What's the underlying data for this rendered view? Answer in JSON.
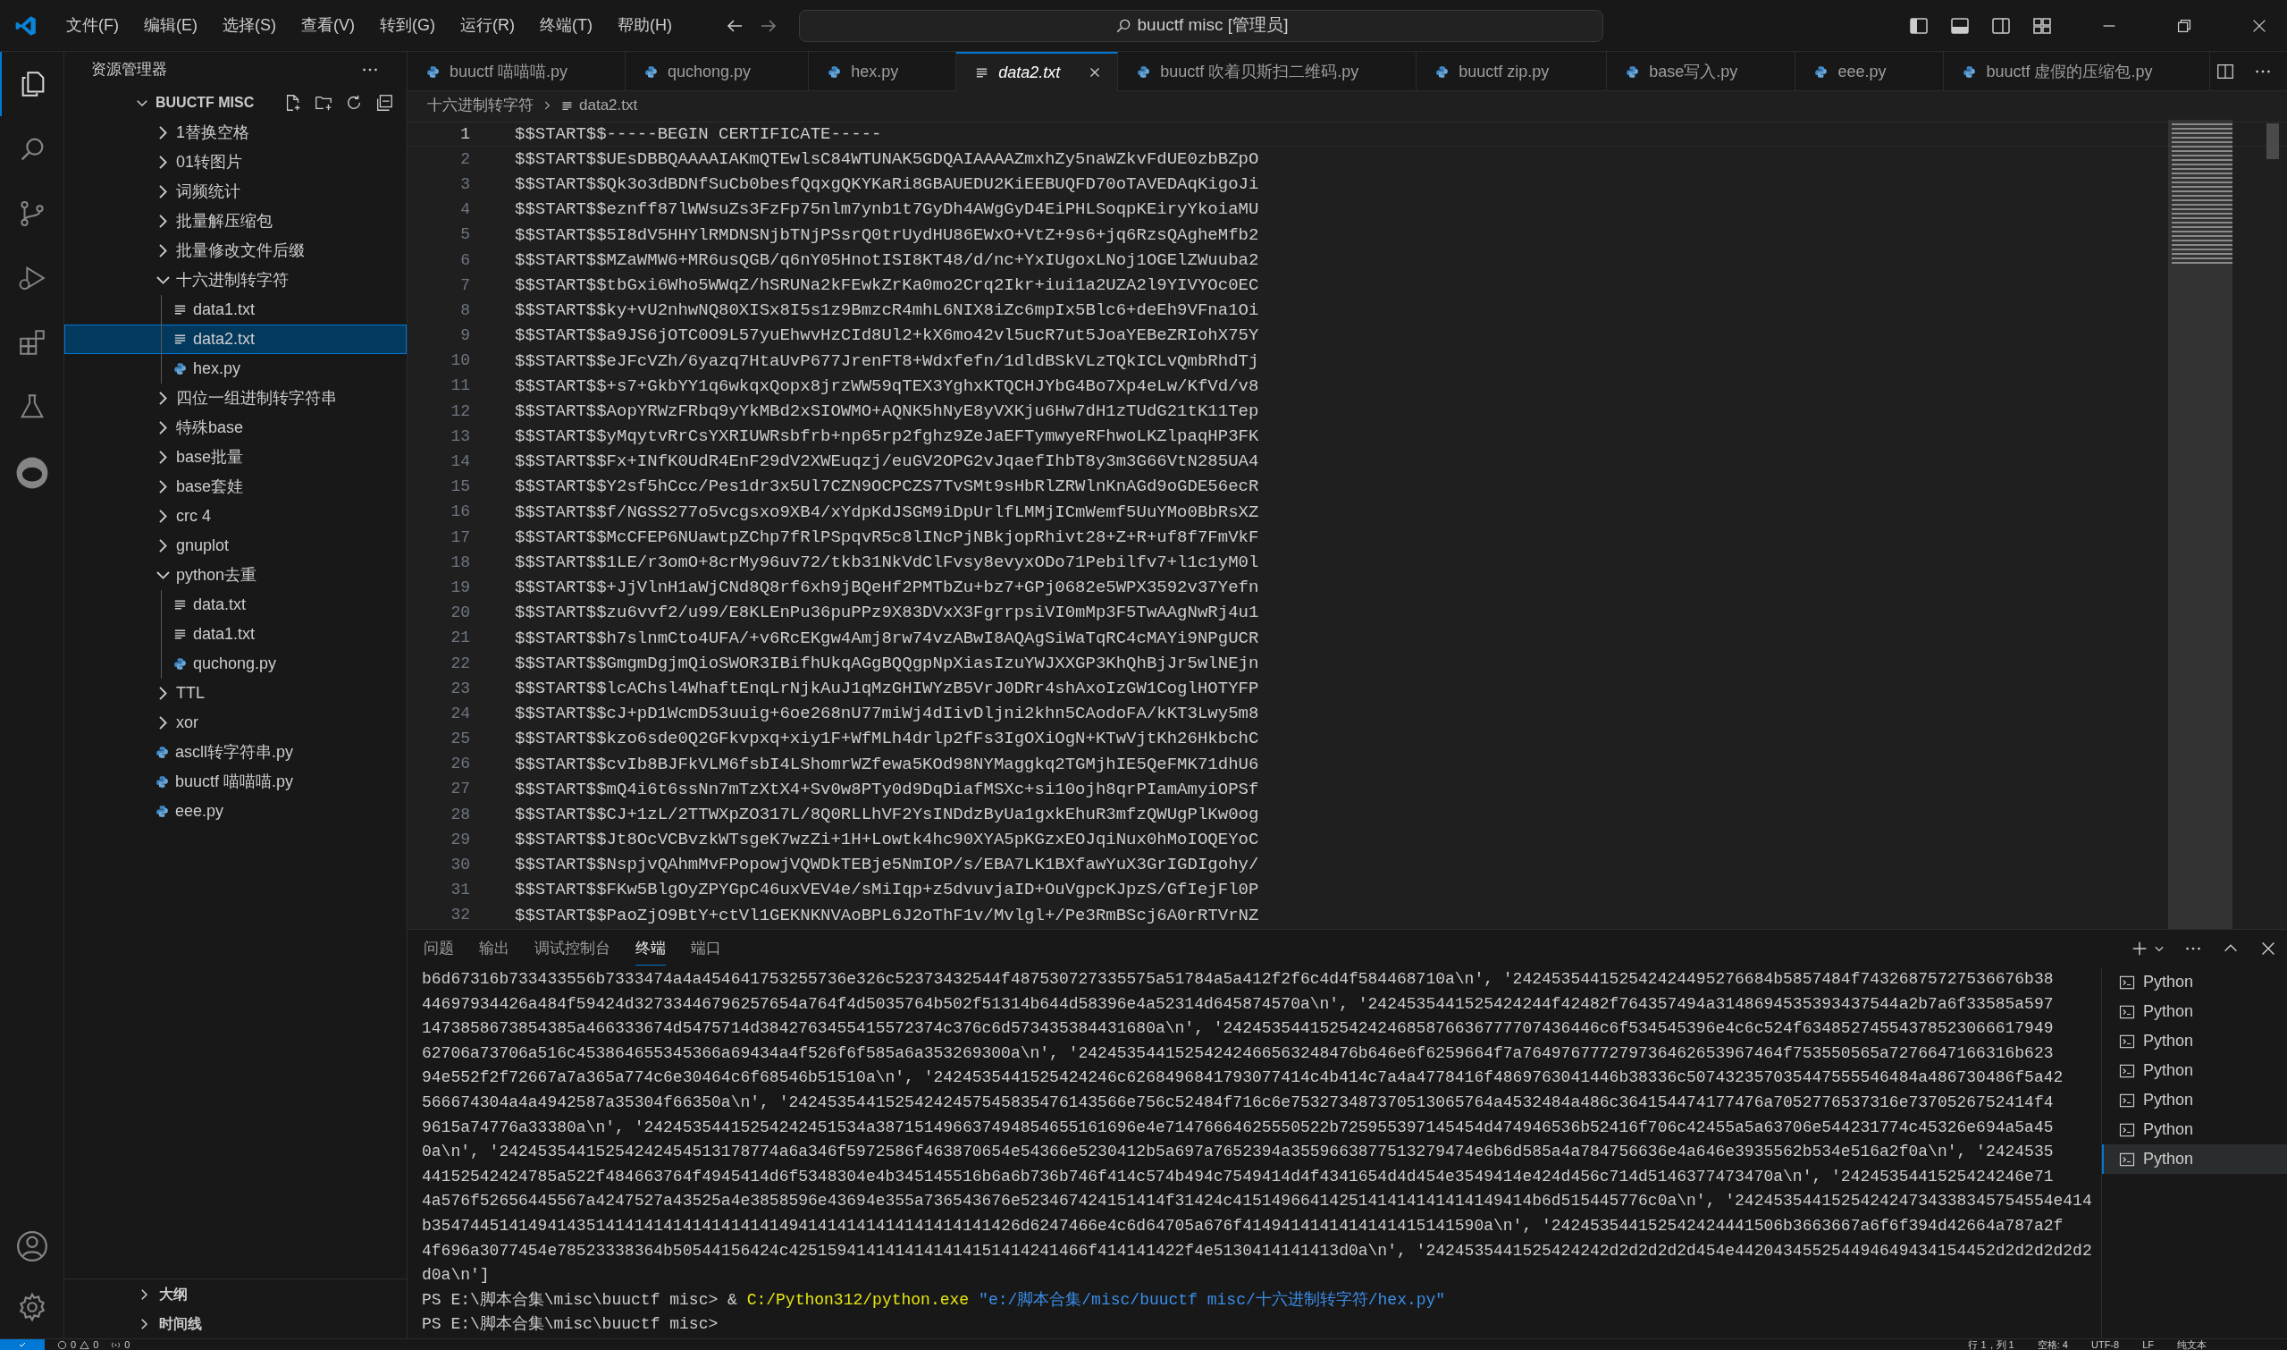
{
  "menu": [
    "文件(F)",
    "编辑(E)",
    "选择(S)",
    "查看(V)",
    "转到(G)",
    "运行(R)",
    "终端(T)",
    "帮助(H)"
  ],
  "command_center": {
    "text": "buuctf misc [管理员]"
  },
  "sidebar": {
    "title": "资源管理器",
    "root": "BUUCTF MISC",
    "items": [
      {
        "kind": "folder",
        "label": "1替换空格",
        "expanded": false,
        "selected": false
      },
      {
        "kind": "folder",
        "label": "01转图片",
        "expanded": false,
        "selected": false
      },
      {
        "kind": "folder",
        "label": "词频统计",
        "expanded": false,
        "selected": false
      },
      {
        "kind": "folder",
        "label": "批量解压缩包",
        "expanded": false,
        "selected": false
      },
      {
        "kind": "folder",
        "label": "批量修改文件后缀",
        "expanded": false,
        "selected": false
      },
      {
        "kind": "folder",
        "label": "十六进制转字符",
        "expanded": true,
        "selected": false,
        "children": [
          {
            "kind": "txt",
            "label": "data1.txt",
            "selected": false
          },
          {
            "kind": "txt",
            "label": "data2.txt",
            "selected": true
          },
          {
            "kind": "py",
            "label": "hex.py",
            "selected": false
          }
        ]
      },
      {
        "kind": "folder",
        "label": "四位一组进制转字符串",
        "expanded": false,
        "selected": false
      },
      {
        "kind": "folder",
        "label": "特殊base",
        "expanded": false,
        "selected": false
      },
      {
        "kind": "folder",
        "label": "base批量",
        "expanded": false,
        "selected": false
      },
      {
        "kind": "folder",
        "label": "base套娃",
        "expanded": false,
        "selected": false
      },
      {
        "kind": "folder",
        "label": "crc 4",
        "expanded": false,
        "selected": false
      },
      {
        "kind": "folder",
        "label": "gnuplot",
        "expanded": false,
        "selected": false
      },
      {
        "kind": "folder",
        "label": "python去重",
        "expanded": true,
        "selected": false,
        "children": [
          {
            "kind": "txt",
            "label": "data.txt",
            "selected": false
          },
          {
            "kind": "txt",
            "label": "data1.txt",
            "selected": false
          },
          {
            "kind": "py",
            "label": "quchong.py",
            "selected": false
          }
        ]
      },
      {
        "kind": "folder",
        "label": "TTL",
        "expanded": false,
        "selected": false
      },
      {
        "kind": "folder",
        "label": "xor",
        "expanded": false,
        "selected": false
      },
      {
        "kind": "py",
        "label": "ascll转字符串.py",
        "selected": false
      },
      {
        "kind": "py",
        "label": "buuctf 喵喵喵.py",
        "selected": false
      },
      {
        "kind": "py",
        "label": "eee.py",
        "selected": false
      }
    ],
    "sections": [
      "大纲",
      "时间线"
    ]
  },
  "tabs": [
    {
      "kind": "py",
      "label": "buuctf 喵喵喵.py",
      "selected": false
    },
    {
      "kind": "py",
      "label": "quchong.py",
      "selected": false
    },
    {
      "kind": "py",
      "label": "hex.py",
      "selected": false
    },
    {
      "kind": "txt",
      "label": "data2.txt",
      "selected": true
    },
    {
      "kind": "py",
      "label": "buuctf 吹着贝斯扫二维码.py",
      "selected": false
    },
    {
      "kind": "py",
      "label": "buuctf zip.py",
      "selected": false
    },
    {
      "kind": "py",
      "label": "base写入.py",
      "selected": false
    },
    {
      "kind": "py",
      "label": "eee.py",
      "selected": false
    },
    {
      "kind": "py",
      "label": "buuctf 虚假的压缩包.py",
      "selected": false
    }
  ],
  "breadcrumb": [
    "十六进制转字符",
    "data2.txt"
  ],
  "editor": {
    "lines": [
      {
        "number": "1",
        "text": "$$START$$-----BEGIN CERTIFICATE-----",
        "selected": true
      },
      {
        "number": "2",
        "text": "$$START$$UEsDBBQAAAAIAKmQTEwlsC84WTUNAK5GDQAIAAAAZmxhZy5naWZkvFdUE0zbBZpO",
        "selected": false
      },
      {
        "number": "3",
        "text": "$$START$$Qk3o3dBDNfSuCb0besfQqxgQKYKaRi8GBAUEDU2KiEEBUQFD70oTAVEDAqKigoJi",
        "selected": false
      },
      {
        "number": "4",
        "text": "$$START$$eznff87lWWsuZs3FzFp75nlm7ynb1t7GyDh4AWgGyD4EiPHLSoqpKEiryYkoiaMU",
        "selected": false
      },
      {
        "number": "5",
        "text": "$$START$$5I8dV5HHYlRMDNSNjbTNjPSsrQ0trUydHU86EWxO+VtZ+9s6+jq6RzsQAgheMfb2",
        "selected": false
      },
      {
        "number": "6",
        "text": "$$START$$MZaWMW6+MR6usQGB/q6nY05HnotISI8KT48/d/nc+YxIUgoxLNoj1OGElZWuuba2",
        "selected": false
      },
      {
        "number": "7",
        "text": "$$START$$tbGxi6Who5WWqZ/hSRUNa2kFEwkZrKa0mo2Crq2Ikr+iui1a2UZA2l9YIVYOc0EC",
        "selected": false
      },
      {
        "number": "8",
        "text": "$$START$$ky+vU2nhwNQ80XISx8I5s1z9BmzcR4mhL6NIX8iZc6mpIx5Blc6+deEh9VFna1Oi",
        "selected": false
      },
      {
        "number": "9",
        "text": "$$START$$a9JS6jOTC0O9L57yuEhwvHzCId8Ul2+kX6mo42vl5ucR7ut5JoaYEBeZRIohX75Y",
        "selected": false
      },
      {
        "number": "10",
        "text": "$$START$$eJFcVZh/6yazq7HtaUvP677JrenFT8+Wdxfefn/1dldBSkVLzTQkICLvQmbRhdTj",
        "selected": false
      },
      {
        "number": "11",
        "text": "$$START$$+s7+GkbYY1q6wkqxQopx8jrzWW59qTEX3YghxKTQCHJYbG4Bo7Xp4eLw/KfVd/v8",
        "selected": false
      },
      {
        "number": "12",
        "text": "$$START$$AopYRWzFRbq9yYkMBd2xSIOWMO+AQNK5hNyE8yVXKju6Hw7dH1zTUdG21tK11Tep",
        "selected": false
      },
      {
        "number": "13",
        "text": "$$START$$yMqytvRrCsYXRIUWRsbfrb+np65rp2fghz9ZeJaEFTymwyeRFhwoLKZlpaqHP3FK",
        "selected": false
      },
      {
        "number": "14",
        "text": "$$START$$Fx+INfK0UdR4EnF29dV2XWEuqzj/euGV2OPG2vJqaefIhbT8y3m3G66VtN285UA4",
        "selected": false
      },
      {
        "number": "15",
        "text": "$$START$$Y2sf5hCcc/Pes1dr3x5Ul7CZN9OCPCZS7TvSMt9sHbRlZRWlnKnAGd9oGDE56ecR",
        "selected": false
      },
      {
        "number": "16",
        "text": "$$START$$f/NGSS277o5vcgsxo9XB4/xYdpKdJSGM9iDpUrlfLMMjICmWemf5UuYMo0BbRsXZ",
        "selected": false
      },
      {
        "number": "17",
        "text": "$$START$$McCFEP6NUawtpZChp7fRlPSpqvR5c8lINcPjNBkjopRhivt28+Z+R+uf8f7FmVkF",
        "selected": false
      },
      {
        "number": "18",
        "text": "$$START$$1LE/r3omO+8crMy96uv72/tkb31NkVdClFvsy8evyxODo71Pebilfv7+l1c1yM0l",
        "selected": false
      },
      {
        "number": "19",
        "text": "$$START$$+JjVlnH1aWjCNd8Q8rf6xh9jBQeHf2PMTbZu+bz7+GPj0682e5WPX3592v37Yefn",
        "selected": false
      },
      {
        "number": "20",
        "text": "$$START$$zu6vvf2/u99/E8KLEnPu36puPPz9X83DVxX3FgrrpsiVI0mMp3F5TwAAgNwRj4u1",
        "selected": false
      },
      {
        "number": "21",
        "text": "$$START$$h7slnmCto4UFA/+v6RcEKgw4Amj8rw74vzABwI8AQAgSiWaTqRC4cMAYi9NPgUCR",
        "selected": false
      },
      {
        "number": "22",
        "text": "$$START$$GmgmDgjmQioSWOR3IBifhUkqAGgBQQgpNpXiasIzuYWJXXGP3KhQhBjJr5wlNEjn",
        "selected": false
      },
      {
        "number": "23",
        "text": "$$START$$lcAChsl4WhaftEnqLrNjkAuJ1qMzGHIWYzB5VrJ0DRr4shAxoIzGW1CoglHOTYFP",
        "selected": false
      },
      {
        "number": "24",
        "text": "$$START$$cJ+pD1WcmD53uuig+6oe268nU77miWj4dIivDljni2khn5CAodoFA/kKT3Lwy5m8",
        "selected": false
      },
      {
        "number": "25",
        "text": "$$START$$kzo6sde0Q2GFkvpxq+xiy1F+WfMLh4drlp2fFs3IgOXiOgN+KTwVjtKh26HkbchC",
        "selected": false
      },
      {
        "number": "26",
        "text": "$$START$$cvIb8BJFkVLM6fsbI4LShomrWZfewa5KOd98NYMaggkq2TGMjhIE5QeFMK71dhU6",
        "selected": false
      },
      {
        "number": "27",
        "text": "$$START$$mQ4i6t6ssNn7mTzXtX4+Sv0w8PTy0d9DqDiafMSXc+si10ojh8qrPIamAmyiOPSf",
        "selected": false
      },
      {
        "number": "28",
        "text": "$$START$$CJ+1zL/2TTWXpZO317L/8Q0RLLhVF2YsINDdzByUa1gxkEhuR3mfzQWUgPlKw0og",
        "selected": false
      },
      {
        "number": "29",
        "text": "$$START$$Jt8OcVCBvzkWTsgeK7wzZi+1H+Lowtk4hc90XYA5pKGzxEOJqiNux0hMoIOQEYoC",
        "selected": false
      },
      {
        "number": "30",
        "text": "$$START$$NspjvQAhmMvFPopowjVQWDkTEBje5NmIOP/s/EBA7LK1BXfawYuX3GrIGDIgohy/",
        "selected": false
      },
      {
        "number": "31",
        "text": "$$START$$FKw5BlgOyZPYGpC46uxVEV4e/sMiIqp+z5dvuvjaID+OuVgpcKJpzS/GfIejFl0P",
        "selected": false
      },
      {
        "number": "32",
        "text": "$$START$$PaoZjO9BtY+ctVl1GEKNKNVAoBPL6J2oThF1v/Mvlgl+/Pe3RmBScj6A0rRTVrNZ",
        "selected": false
      }
    ]
  },
  "panel": {
    "tabs": [
      {
        "label": "问题",
        "selected": false
      },
      {
        "label": "输出",
        "selected": false
      },
      {
        "label": "调试控制台",
        "selected": false
      },
      {
        "label": "终端",
        "selected": true
      },
      {
        "label": "端口",
        "selected": false
      }
    ],
    "output": [
      "b6d67316b733433556b7333474a4a454641753255736e326c52373432544f487530727335575a51784a5a412f2f6c4d4f584468710a\\n', '242453544152542424495276684b5857484f74326875727536676b38",
      "44697934426a484f59424d32733446796257654a764f4d5035764b502f51314b644d58396e4a52314d645874570a\\n', '2424535441525424244f42482f764357494a3148694535393437544a2b7a6f33585a597",
      "1473858673854385a466333674d5475714d3842763455415572374c376c6d573435384431680a\\n', '242453544152542424685876636777707436446c6f534545396e4c6c524f63485274554378523066617949",
      "62706a73706a516c453864655345366a69434a4f526f6f585a6a353269300a\\n', '24245354415254242466563248476b646e6f6259664f7a764976777279736462653967464f753550565a7276647166316b623",
      "94e552f2f72667a7a365a774c6e30464c6f68546b51510a\\n', '2424535441525424246c6268496841793077414c4b414c7a4a4778416f4869763041446b38336c507432357035447555546484a486730486f5a42",
      "566674304a4a4942587a35304f66350a\\n', '24245354415254242457545835476143566e756c52484f716c6e753273487370513065764a4532484a486c364154474177476a7052776537316e7370526752414f4",
      "9615a74776a33380a\\n', '24245354415254242451534a387151496637494854655161696e4e71476664625550522b725955397145454d474946536b52416f706c42455a5a63706e544231774c45326e694a5a45",
      "0a\\n', '24245354415254242454513178774a6a346f5972586f463870654e54366e5230412b5a697a7652394a3559663877513279474e6b6d585a4a784756636e4a646e3935562b534e516a2f0a\\n', '2424535",
      "44152542424785a522f484663764f4945414d6f5348304e4b345145516b6a6b736b746f414c574b494c7549414d4f4341654d4d454e3549414e424d456c714d5146377473470a\\n', '2424535441525424246e71",
      "4a576f52656445567a4247527a43525a4e3858596e43694e355a736543676e523467424151414f31424c4151496641425141414141414149414b6d515445776c0a\\n', '242453544152542424734338345754554e414",
      "b3547445141494143514141414141414141414941414141414141414141426d6247466e4c6d64705a676f4149414141414141415141590a\\n', '242453544152542424441506b3663667a6f6f394d42664a787a2f",
      "4f696a3077454e78523338364b50544156424c4251594141414141414151414241466f414141422f4e5130414141413d0a\\n', '2424535441525424242d2d2d2d2d454e442043455254494649434154452d2d2d2d2d2",
      "d0a\\n']"
    ],
    "commands": [
      {
        "prompt": "PS E:\\脚本合集\\misc\\buuctf misc> ",
        "parts": [
          {
            "kind": "plain",
            "text": "& "
          },
          {
            "kind": "path",
            "text": "C:/Python312/python.exe"
          },
          {
            "kind": "string",
            "text": "\"e:/脚本合集/misc/buuctf misc/十六进制转字符/hex.py\""
          }
        ]
      },
      {
        "prompt": "PS E:\\脚本合集\\misc\\buuctf misc> "
      }
    ],
    "terminals": [
      {
        "label": "Python",
        "selected": false
      },
      {
        "label": "Python",
        "selected": false
      },
      {
        "label": "Python",
        "selected": false
      },
      {
        "label": "Python",
        "selected": false
      },
      {
        "label": "Python",
        "selected": false
      },
      {
        "label": "Python",
        "selected": false
      },
      {
        "label": "Python",
        "selected": true
      }
    ]
  },
  "status_bar": {
    "errors": "0",
    "warnings": "0",
    "ports": "0",
    "position": "行 1，列 1",
    "indent": "空格: 4",
    "encoding": "UTF-8",
    "eol": "LF",
    "language": "纯文本"
  }
}
